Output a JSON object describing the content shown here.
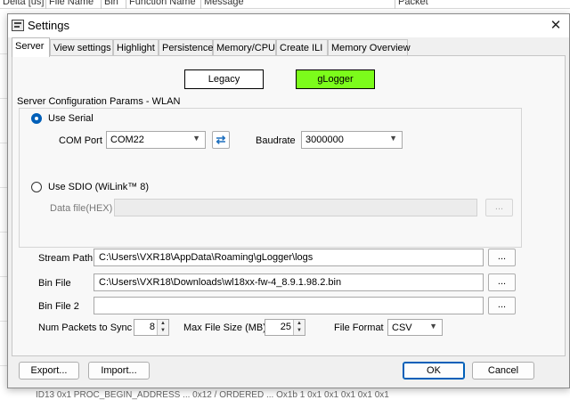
{
  "background": {
    "columns": [
      "Delta [us]",
      "File Name",
      "Bin",
      "Function Name",
      "Message",
      "Packet"
    ],
    "bottom_text": "ID13 0x1  PROC_BEGIN_ADDRESS ...   0x12 / ORDERED ...  Ox1b  1  0x1  0x1  0x1  0x1  0x1"
  },
  "window": {
    "title": "Settings",
    "close_label": "✕"
  },
  "tabs": [
    "Server",
    "View settings",
    "Highlight",
    "Persistence",
    "Memory/CPU",
    "Create ILI",
    "Memory Overview"
  ],
  "active_tab": "Server",
  "mode": {
    "legacy_label": "Legacy",
    "glogger_label": "gLogger",
    "selected": "gLogger",
    "glogger_color": "#7CFC1B"
  },
  "server_group": {
    "title": "Server Configuration Params - WLAN",
    "use_serial_label": "Use Serial",
    "use_serial_checked": true,
    "com_port_label": "COM Port",
    "com_port_value": "COM22",
    "baudrate_label": "Baudrate",
    "baudrate_value": "3000000",
    "use_sdio_label": "Use SDIO (WiLink™ 8)",
    "use_sdio_checked": false,
    "data_file_label": "Data file(HEX)",
    "data_file_value": "",
    "data_file_browse": "..."
  },
  "paths": {
    "stream_path_label": "Stream Path",
    "stream_path_value": "C:\\Users\\VXR18\\AppData\\Roaming\\gLogger\\logs",
    "bin_file_label": "Bin File",
    "bin_file_value": "C:\\Users\\VXR18\\Downloads\\wl18xx-fw-4_8.9.1.98.2.bin",
    "bin_file2_label": "Bin File 2",
    "bin_file2_value": "",
    "browse_label": "..."
  },
  "options": {
    "num_packets_label": "Num Packets to Sync",
    "num_packets_value": "8",
    "max_file_size_label": "Max File Size (MB)",
    "max_file_size_value": "25",
    "file_format_label": "File Format",
    "file_format_value": "CSV"
  },
  "footer": {
    "export_label": "Export...",
    "import_label": "Import...",
    "ok_label": "OK",
    "cancel_label": "Cancel"
  },
  "colors": {
    "accent": "#005FB8",
    "refresh_icon": "#1E6FBE"
  },
  "icons": {
    "window": "settings-window-icon",
    "refresh": "refresh-icon",
    "dropdown": "chevron-down-icon",
    "spinner": "spin-arrows-icon"
  }
}
